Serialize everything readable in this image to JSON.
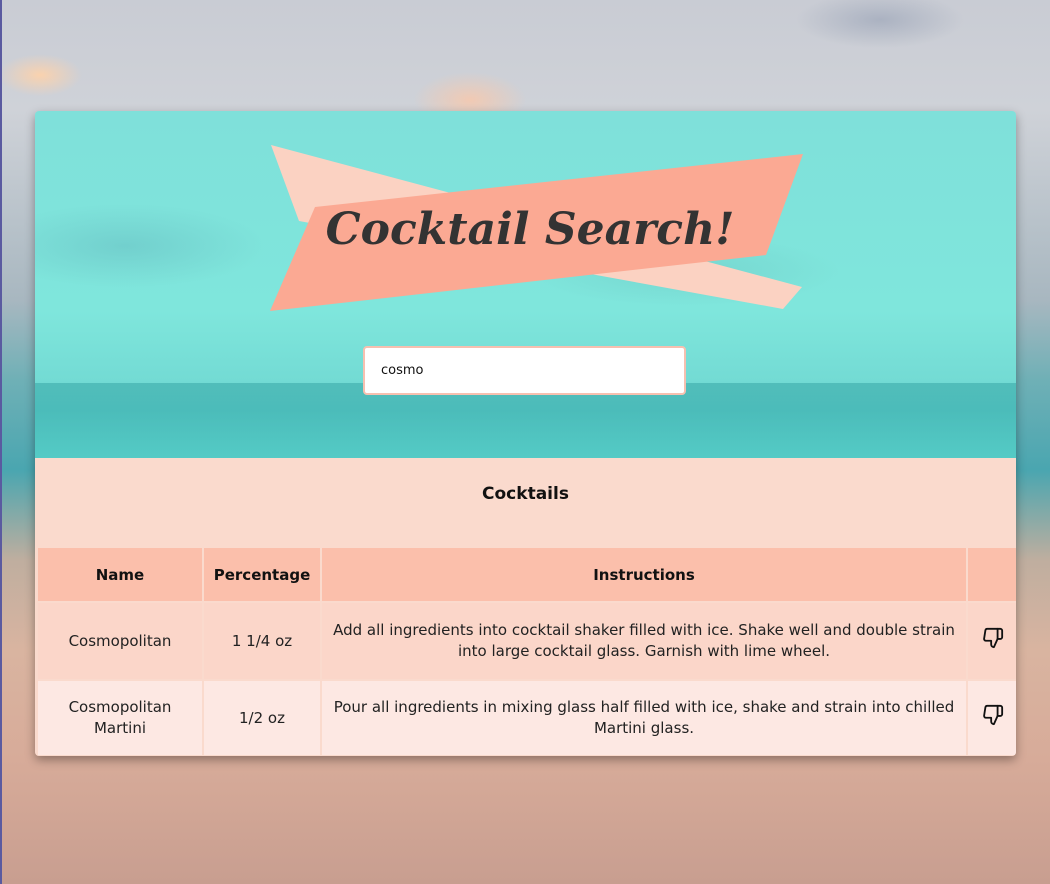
{
  "app": {
    "title": "Cocktail Search!"
  },
  "search": {
    "value": "cosmo",
    "placeholder": ""
  },
  "results": {
    "heading": "Cocktails",
    "columns": [
      "Name",
      "Percentage",
      "Instructions",
      ""
    ],
    "rows": [
      {
        "name": "Cosmopolitan",
        "percentage": "1 1/4 oz",
        "instructions": "Add all ingredients into cocktail shaker filled with ice. Shake well and double strain into large cocktail glass. Garnish with lime wheel.",
        "action_icon": "thumbs-down-icon"
      },
      {
        "name": "Cosmopolitan Martini",
        "percentage": "1/2 oz",
        "instructions": "Pour all ingredients in mixing glass half filled with ice, shake and strain into chilled Martini glass.",
        "action_icon": "thumbs-down-icon"
      }
    ]
  },
  "colors": {
    "banner_front": "#fba993",
    "banner_back": "#fbd2c2",
    "title_text": "#333333",
    "hero_sea": "#7fe0da",
    "results_bg": "#fadacd",
    "header_bg": "#fbbfab",
    "row_odd_bg": "#fbd6c9",
    "row_even_bg": "#fde8e3"
  }
}
